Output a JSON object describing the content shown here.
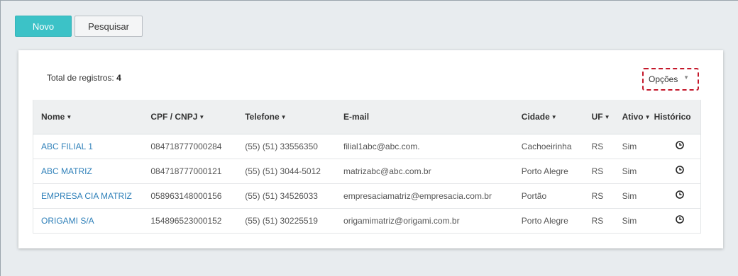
{
  "toolbar": {
    "new_label": "Novo",
    "search_label": "Pesquisar"
  },
  "summary": {
    "total_label": "Total de registros:",
    "total_value": "4"
  },
  "options": {
    "label": "Opções"
  },
  "table": {
    "headers": {
      "nome": "Nome",
      "cpf": "CPF / CNPJ",
      "telefone": "Telefone",
      "email": "E-mail",
      "cidade": "Cidade",
      "uf": "UF",
      "ativo": "Ativo",
      "historico": "Histórico"
    },
    "rows": [
      {
        "nome": "ABC FILIAL 1",
        "cpf": "084718777000284",
        "telefone": "(55) (51) 33556350",
        "email": "filial1abc@abc.com.",
        "cidade": "Cachoeirinha",
        "uf": "RS",
        "ativo": "Sim"
      },
      {
        "nome": "ABC MATRIZ",
        "cpf": "084718777000121",
        "telefone": "(55) (51) 3044-5012",
        "email": "matrizabc@abc.com.br",
        "cidade": "Porto Alegre",
        "uf": "RS",
        "ativo": "Sim"
      },
      {
        "nome": "EMPRESA CIA MATRIZ",
        "cpf": "058963148000156",
        "telefone": "(55) (51) 34526033",
        "email": "empresaciamatriz@empresacia.com.br",
        "cidade": "Portão",
        "uf": "RS",
        "ativo": "Sim"
      },
      {
        "nome": "ORIGAMI S/A",
        "cpf": "154896523000152",
        "telefone": "(55) (51) 30225519",
        "email": "origamimatriz@origami.com.br",
        "cidade": "Porto Alegre",
        "uf": "RS",
        "ativo": "Sim"
      }
    ]
  },
  "icons": {
    "sort": "caret-down-icon",
    "history": "clock-icon",
    "options_caret": "triangle-down-icon"
  },
  "colors": {
    "primary": "#3cc2c7",
    "link": "#2f80b9",
    "highlight_border": "#c4172a"
  }
}
